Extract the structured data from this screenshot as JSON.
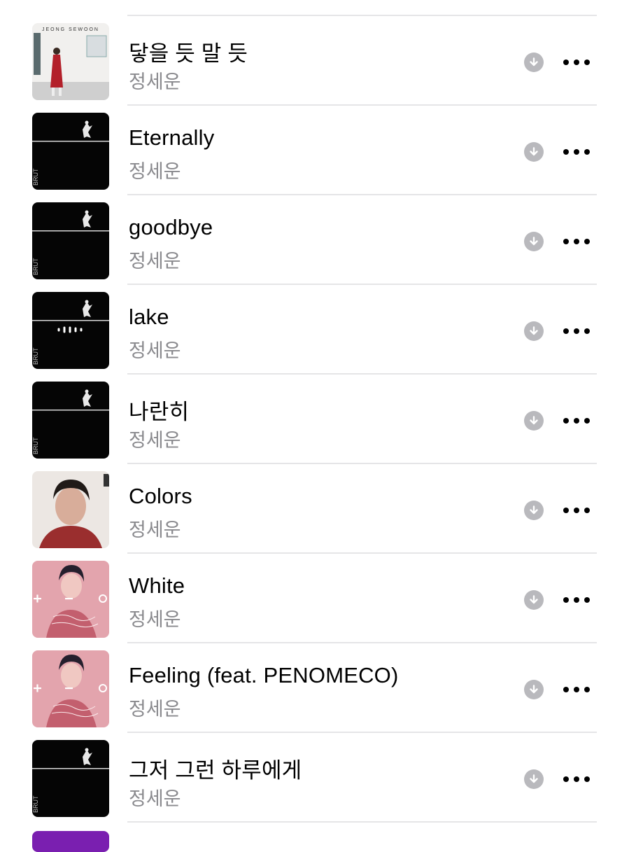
{
  "songs": [
    {
      "title": "닿을 듯 말 듯",
      "artist": "정세운",
      "art": "album-jeong-sewoon",
      "cover_text": "JEONG SEWOON"
    },
    {
      "title": "Eternally",
      "artist": "정세운",
      "art": "album-brut",
      "cover_text": "BRUT"
    },
    {
      "title": "goodbye",
      "artist": "정세운",
      "art": "album-brut",
      "cover_text": "BRUT"
    },
    {
      "title": "lake",
      "artist": "정세운",
      "art": "album-brut-playing",
      "cover_text": "BRUT"
    },
    {
      "title": "나란히",
      "artist": "정세운",
      "art": "album-brut",
      "cover_text": "BRUT"
    },
    {
      "title": "Colors",
      "artist": "정세운",
      "art": "album-colors"
    },
    {
      "title": "White",
      "artist": "정세운",
      "art": "album-plus-minus"
    },
    {
      "title": "Feeling (feat. PENOMECO)",
      "artist": "정세운",
      "art": "album-plus-minus"
    },
    {
      "title": "그저 그런 하루에게",
      "artist": "정세운",
      "art": "album-brut",
      "cover_text": "BRUT"
    }
  ],
  "icons": {
    "download": "download-circle-icon",
    "more": "ellipsis-icon",
    "now_playing": "now-playing-indicator-icon"
  },
  "colors": {
    "title": "#000000",
    "artist": "#8a8a8e",
    "divider": "#e5e5e7",
    "download_icon": "#b9b9bd",
    "next_album": "#7a1fb0"
  }
}
